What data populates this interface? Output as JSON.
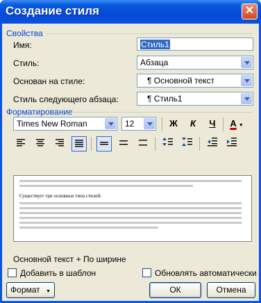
{
  "window": {
    "title": "Создание стиля",
    "close_glyph": "✕"
  },
  "properties": {
    "section_title": "Свойства",
    "name_label": "Имя:",
    "name_value": "Стиль1",
    "type_label": "Стиль:",
    "type_value": "Абзаца",
    "based_label": "Основан на стиле:",
    "based_value": "¶ Основной текст",
    "next_label": "Стиль следующего абзаца:",
    "next_value": "¶ Стиль1"
  },
  "formatting": {
    "section_title": "Форматирование",
    "font_value": "Times New Roman",
    "size_value": "12",
    "bold_label": "Ж",
    "italic_label": "К",
    "underline_label": "Ч",
    "font_color_label": "A",
    "font_color": "#cc0000"
  },
  "preview": {
    "sample_text": "Существует три основных типа стилей:"
  },
  "description": "Основной текст + По ширине",
  "options": {
    "add_template_label": "Добавить в шаблон",
    "auto_update_label": "Обновлять автоматически"
  },
  "buttons": {
    "format_label": "Формат",
    "format_arrow": "▼",
    "ok_label": "ОК",
    "cancel_label": "Отмена"
  },
  "colors": {
    "title_bar": "#0a55e0",
    "dialog_bg": "#ece9d8",
    "section_text": "#0046d5",
    "selection": "#316ac5"
  }
}
